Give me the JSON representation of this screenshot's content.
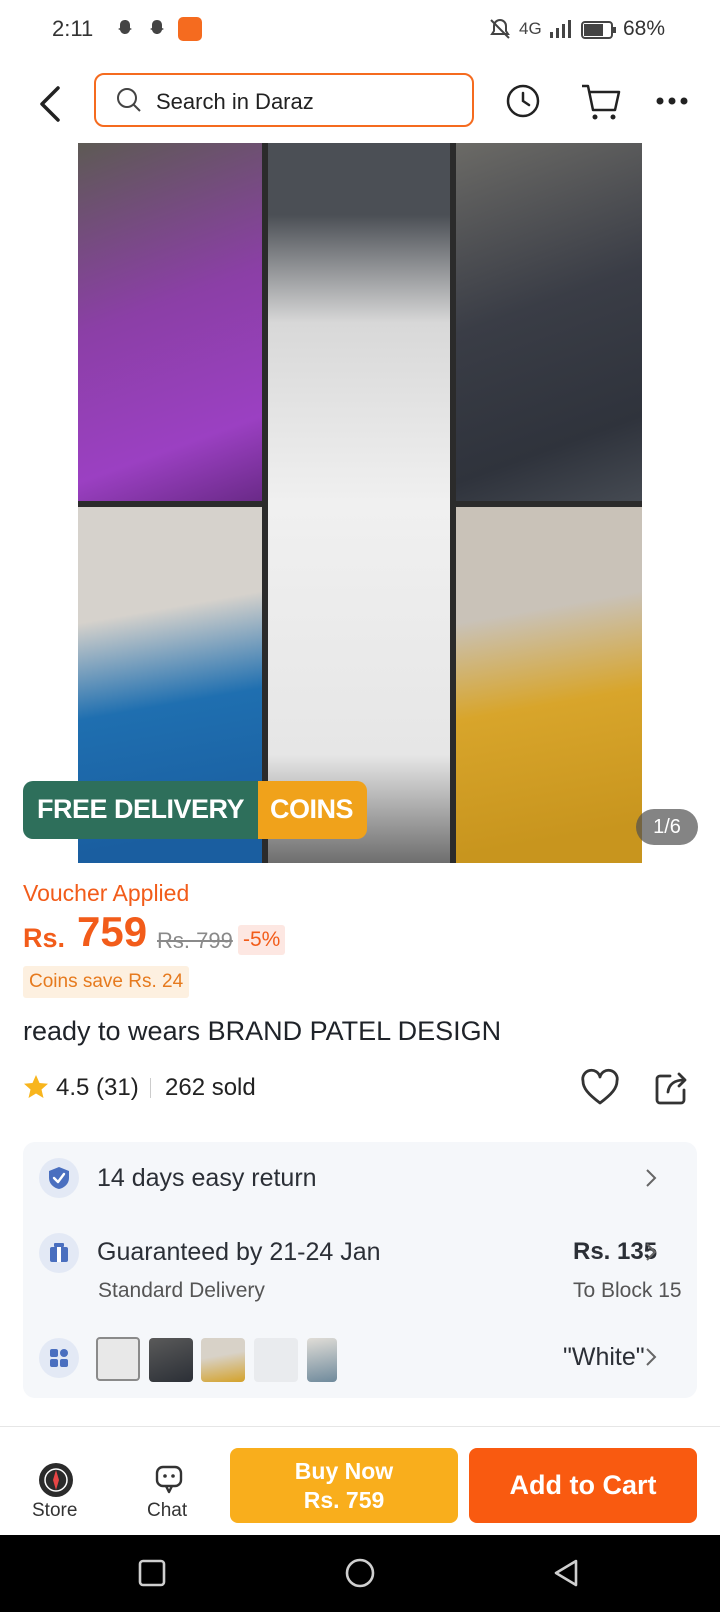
{
  "status_bar": {
    "time": "2:11",
    "network": "4G",
    "battery": "68%"
  },
  "header": {
    "search_placeholder": "Search in Daraz"
  },
  "gallery": {
    "badge_left": "FREE DELIVERY",
    "badge_right": "COINS",
    "counter": "1/6"
  },
  "pricing": {
    "voucher": "Voucher Applied",
    "currency": "Rs.",
    "price": "759",
    "old_price": "Rs. 799",
    "discount": "-5%",
    "coins_save": "Coins save Rs. 24"
  },
  "product": {
    "title": "ready to wears BRAND PATEL DESIGN",
    "rating": "4.5 (31)",
    "sold": "262 sold"
  },
  "info": {
    "return": "14 days easy return",
    "delivery_title": "Guaranteed by 21-24 Jan",
    "delivery_sub": "Standard Delivery",
    "delivery_price": "Rs. 135",
    "delivery_to": "To Block 15",
    "variant": "\"White\""
  },
  "bottom_bar": {
    "store": "Store",
    "chat": "Chat",
    "buy_now": "Buy Now",
    "buy_now_price": "Rs. 759",
    "add_to_cart": "Add to Cart"
  },
  "colors": {
    "brand": "#f56b1f",
    "buy_now": "#f9ae1c",
    "add_to_cart": "#f95a10",
    "free_delivery": "#2e6f5b"
  }
}
